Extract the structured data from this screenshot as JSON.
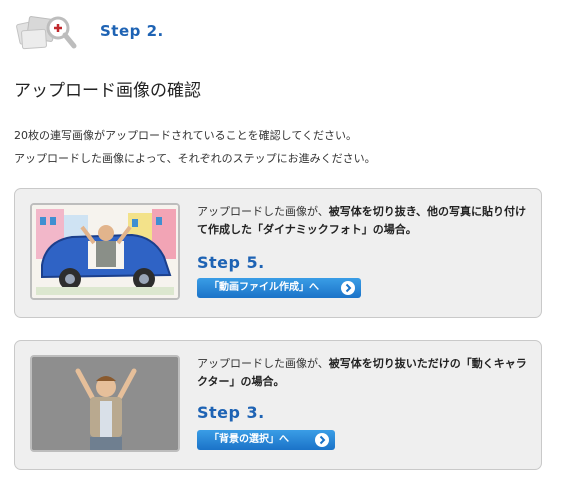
{
  "header": {
    "icon": "photo-magnify-icon",
    "step_label": "Step 2."
  },
  "page_title": "アップロード画像の確認",
  "intro": {
    "line1": "20枚の連写画像がアップロードされていることを確認してください。",
    "line2": "アップロードした画像によって、それぞれのステップにお進みください。"
  },
  "options": [
    {
      "thumbnail": "child-in-drawn-car-image",
      "desc_pre": "アップロードした画像が、",
      "desc_bold": "被写体を切り抜き、他の写真に貼り付けて作成した「ダイナミックフォト」の場合。",
      "step": "Step 5.",
      "button_label": "「動画ファイル作成」へ"
    },
    {
      "thumbnail": "child-cutout-image",
      "desc_pre": "アップロードした画像が、",
      "desc_bold": "被写体を切り抜いただけの「動くキャラクター」の場合。",
      "step": "Step 3.",
      "button_label": "「背景の選択」へ"
    }
  ],
  "colors": {
    "accent": "#1e63b4",
    "button": "#1b73c8",
    "card_bg": "#efefef"
  }
}
